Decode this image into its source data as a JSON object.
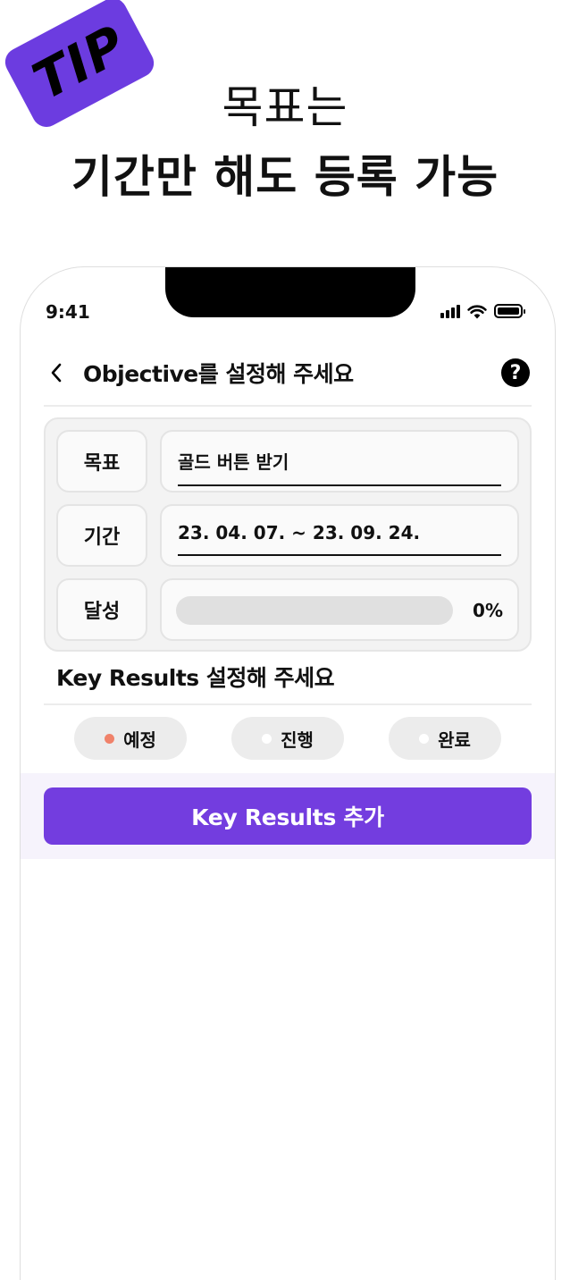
{
  "promo": {
    "badge": "TIP",
    "headline_line1": "목표는",
    "headline_line2": "기간만 해도 등록 가능"
  },
  "status_bar": {
    "time": "9:41",
    "icons": [
      "signal-icon",
      "wifi-icon",
      "battery-icon"
    ]
  },
  "nav": {
    "back_icon": "chevron-left-icon",
    "title": "Objective를 설정해 주세요",
    "help_icon": "question-mark-icon",
    "help_glyph": "?"
  },
  "objective": {
    "goal_label": "목표",
    "goal_value": "골드 버튼 받기",
    "period_label": "기간",
    "period_value": "23. 04. 07. ~ 23. 09. 24.",
    "achievement_label": "달성",
    "achievement_value": "0%",
    "achievement_fraction": 0
  },
  "key_results": {
    "heading": "Key Results 설정해 주세요",
    "filters": [
      {
        "label": "예정",
        "active": true
      },
      {
        "label": "진행",
        "active": false
      },
      {
        "label": "완료",
        "active": false
      }
    ],
    "add_button": "Key Results 추가"
  },
  "colors": {
    "brand_purple": "#733ddf",
    "badge_purple": "#6c3ce0",
    "active_dot": "#f0826a",
    "action_band": "#f6f3fc"
  }
}
